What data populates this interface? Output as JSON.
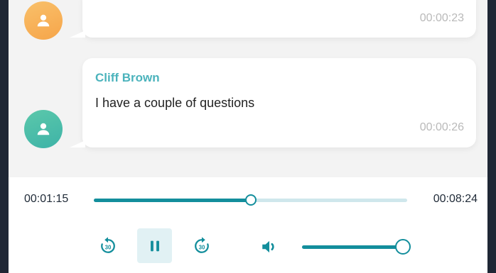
{
  "messages": [
    {
      "sender": "",
      "text": "",
      "time": "00:00:23",
      "avatar_color": "#f6a54a"
    },
    {
      "sender": "Cliff Brown",
      "text": "I have a couple of questions",
      "time": "00:00:26",
      "avatar_color": "#3eb3a8"
    }
  ],
  "player": {
    "current_time": "00:01:15",
    "duration": "00:08:24",
    "progress": 0.5,
    "volume": 1.0,
    "rewind_label": "30",
    "forward_label": "30",
    "state": "playing",
    "accent_color": "#138e9c",
    "track_color": "#cfe7ec"
  },
  "icons": {
    "avatar": "user-icon",
    "rewind": "rewind-30-icon",
    "pause": "pause-icon",
    "forward": "forward-30-icon",
    "volume": "volume-icon"
  }
}
